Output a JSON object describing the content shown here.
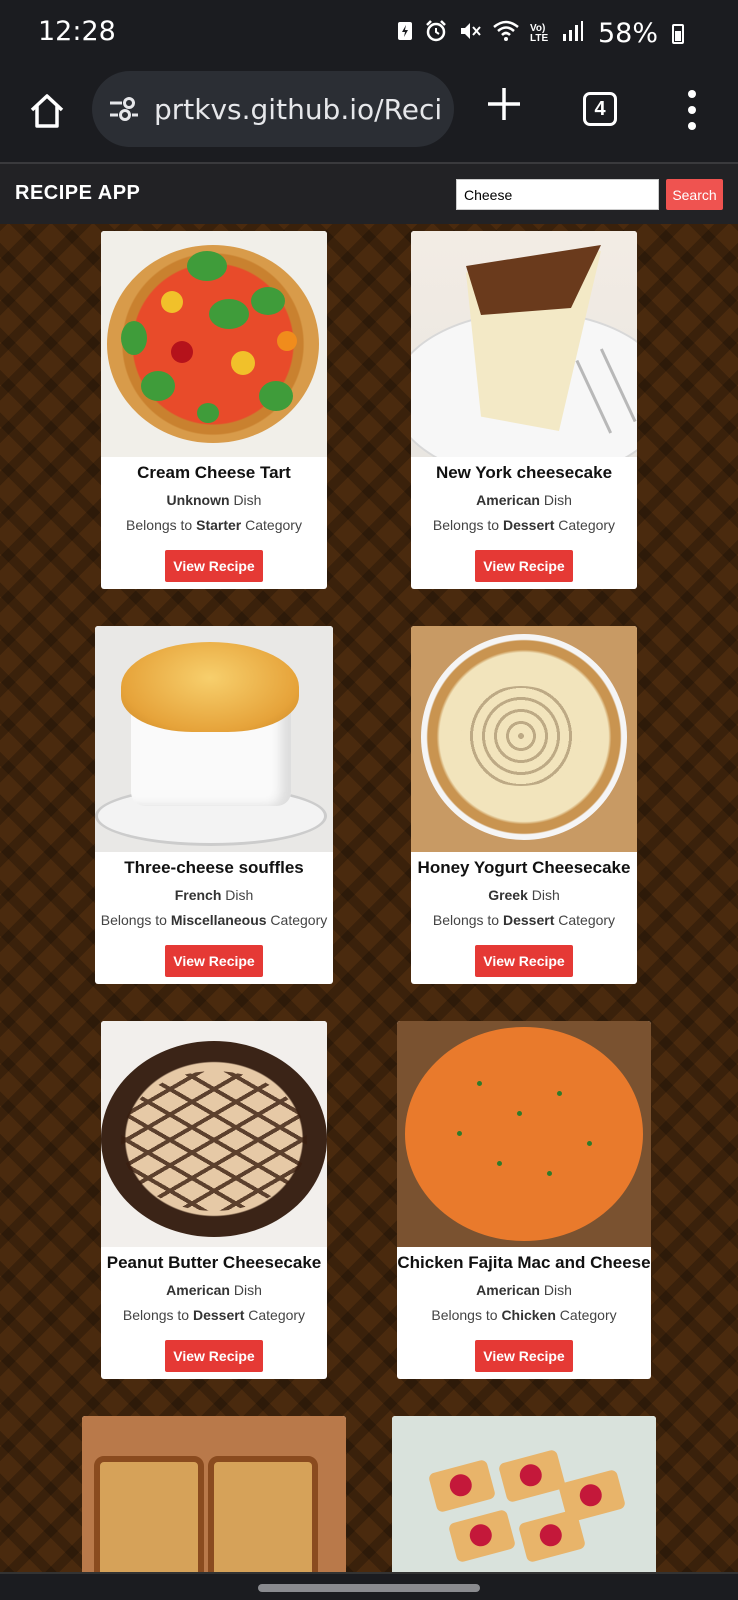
{
  "status_bar": {
    "time": "12:28",
    "battery": "58%",
    "network": "Vo) LTE"
  },
  "browser": {
    "url": "prtkvs.github.io/Reci",
    "tab_count": "4"
  },
  "app": {
    "title": "RECIPE APP",
    "search_value": "Cheese",
    "search_button": "Search",
    "belongs_prefix": "Belongs to",
    "category_suffix": "Category",
    "dish_suffix": "Dish",
    "view_button": "View Recipe"
  },
  "recipes": [
    {
      "title": "Cream Cheese Tart",
      "area": "Unknown",
      "category": "Starter"
    },
    {
      "title": "New York cheesecake",
      "area": "American",
      "category": "Dessert"
    },
    {
      "title": "Three-cheese souffles",
      "area": "French",
      "category": "Miscellaneous"
    },
    {
      "title": "Honey Yogurt Cheesecake",
      "area": "Greek",
      "category": "Dessert"
    },
    {
      "title": "Peanut Butter Cheesecake",
      "area": "American",
      "category": "Dessert"
    },
    {
      "title": "Chicken Fajita Mac and Cheese",
      "area": "American",
      "category": "Chicken"
    }
  ]
}
